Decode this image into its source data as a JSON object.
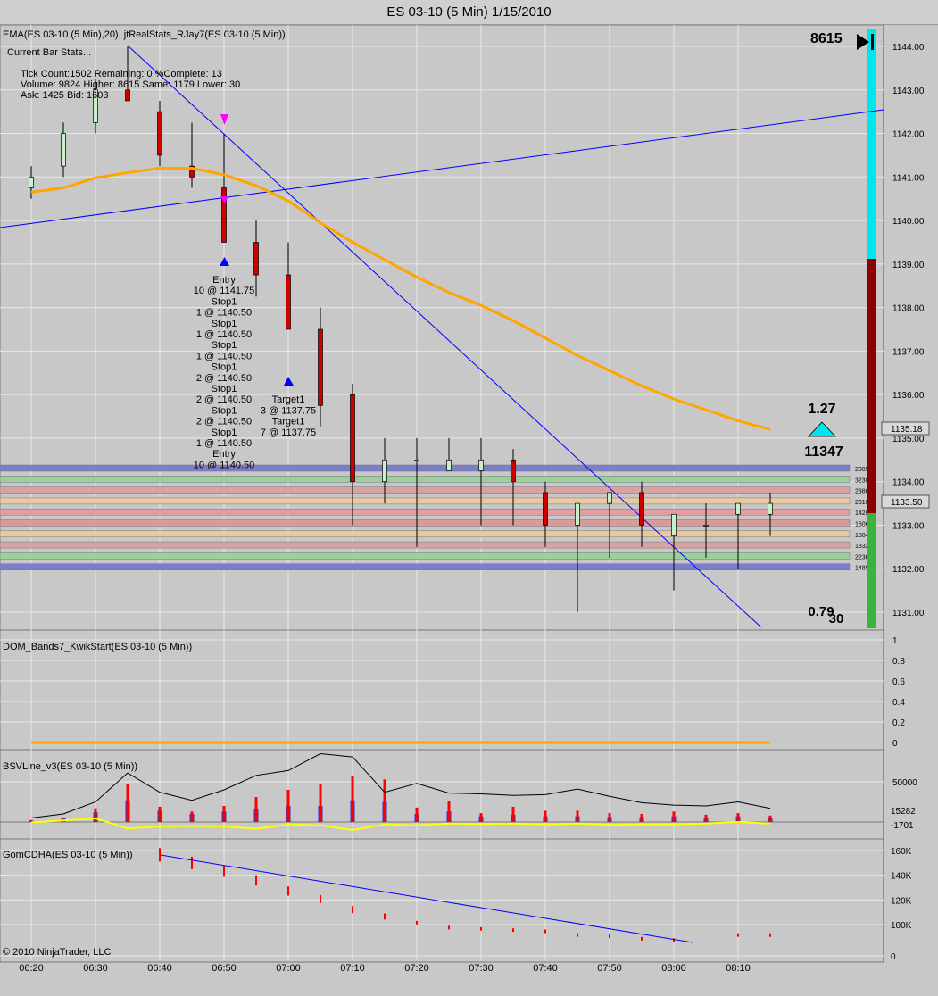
{
  "window": {
    "title": "ES 03-10 (5 Min)  1/15/2010"
  },
  "price_panel": {
    "indicator_label": "EMA(ES 03-10 (5 Min),20), jtRealStats_RJay7(ES 03-10 (5 Min))",
    "current_bar_stats_label": "Current Bar Stats...",
    "stats_line1": "Tick Count:1502   Remaining: 0   %Complete: 13",
    "stats_line2": "Volume: 9824   Higher: 8615   Same: 1179   Lower: 30",
    "stats_line3": "Ask: 1425   Bid: 1603",
    "top_right_value": "8615",
    "ratio_value": "1.27",
    "volume_value": "11347",
    "bottom_ratio": "0.79",
    "bottom_count": "30",
    "last_price_tag": "1133.50",
    "prev_price_tag": "1135.18",
    "trade_annotations_left": [
      "Entry",
      "10 @ 1141.75",
      "Stop1",
      "1 @ 1140.50",
      "Stop1",
      "1 @ 1140.50",
      "Stop1",
      "1 @ 1140.50",
      "Stop1",
      "2 @ 1140.50",
      "Stop1",
      "2 @ 1140.50",
      "Stop1",
      "2 @ 1140.50",
      "Stop1",
      "1 @ 1140.50",
      "Entry",
      "10 @ 1140.50"
    ],
    "trade_annotations_right": [
      "Target1",
      "3 @ 1137.75",
      "Target1",
      "7 @ 1137.75"
    ]
  },
  "dom_panel": {
    "label": "DOM_Bands7_KwikStart(ES 03-10 (5 Min))",
    "value_tag": "0"
  },
  "bsv_panel": {
    "label": "BSVLine_v3(ES 03-10 (5 Min))",
    "tag_top": "15282",
    "tag_bottom": "-1701"
  },
  "cdha_panel": {
    "label": "GomCDHA(ES 03-10 (5 Min))"
  },
  "copyright": "© 2010 NinjaTrader, LLC",
  "colors": {
    "background": "#c8c8c8",
    "ema": "#ffa500",
    "trendline": "#0000ff",
    "up_candle": "#c8f0c8",
    "down_candle": "#cc0000",
    "bsv_line": "#ffff00",
    "cdha": "#ff0000"
  },
  "chart_data": [
    {
      "type": "candlestick",
      "title": "ES 03-10 (5 Min)  1/15/2010",
      "x_ticks": [
        "06:20",
        "06:30",
        "06:40",
        "06:50",
        "07:00",
        "07:10",
        "07:20",
        "07:30",
        "07:40",
        "07:50",
        "08:00",
        "08:10"
      ],
      "y_ticks": [
        "1131.00",
        "1132.00",
        "1133.00",
        "1134.00",
        "1135.00",
        "1136.00",
        "1137.00",
        "1138.00",
        "1139.00",
        "1140.00",
        "1141.00",
        "1142.00",
        "1143.00",
        "1144.00"
      ],
      "ylim": [
        1130.6,
        1144.2
      ],
      "candles": [
        {
          "t": "06:20",
          "o": 1140.75,
          "h": 1141.25,
          "l": 1140.5,
          "c": 1141.0
        },
        {
          "t": "06:25",
          "o": 1141.25,
          "h": 1142.25,
          "l": 1141.0,
          "c": 1142.0
        },
        {
          "t": "06:30",
          "o": 1142.25,
          "h": 1143.25,
          "l": 1142.0,
          "c": 1143.0
        },
        {
          "t": "06:35",
          "o": 1143.0,
          "h": 1144.0,
          "l": 1142.75,
          "c": 1142.75
        },
        {
          "t": "06:40",
          "o": 1142.5,
          "h": 1142.75,
          "l": 1141.25,
          "c": 1141.5
        },
        {
          "t": "06:45",
          "o": 1141.25,
          "h": 1142.25,
          "l": 1140.75,
          "c": 1141.0
        },
        {
          "t": "06:50",
          "o": 1140.75,
          "h": 1142.0,
          "l": 1139.5,
          "c": 1139.5
        },
        {
          "t": "06:55",
          "o": 1139.5,
          "h": 1140.0,
          "l": 1138.25,
          "c": 1138.75
        },
        {
          "t": "07:00",
          "o": 1138.75,
          "h": 1139.5,
          "l": 1137.5,
          "c": 1137.5
        },
        {
          "t": "07:05",
          "o": 1137.5,
          "h": 1138.0,
          "l": 1135.25,
          "c": 1135.75
        },
        {
          "t": "07:10",
          "o": 1136.0,
          "h": 1136.25,
          "l": 1133.0,
          "c": 1134.0
        },
        {
          "t": "07:15",
          "o": 1134.0,
          "h": 1135.0,
          "l": 1133.5,
          "c": 1134.5
        },
        {
          "t": "07:20",
          "o": 1134.5,
          "h": 1135.0,
          "l": 1132.5,
          "c": 1134.5
        },
        {
          "t": "07:25",
          "o": 1134.25,
          "h": 1135.0,
          "l": 1134.25,
          "c": 1134.5
        },
        {
          "t": "07:30",
          "o": 1134.25,
          "h": 1135.0,
          "l": 1133.0,
          "c": 1134.5
        },
        {
          "t": "07:35",
          "o": 1134.5,
          "h": 1134.75,
          "l": 1133.0,
          "c": 1134.0
        },
        {
          "t": "07:40",
          "o": 1133.75,
          "h": 1134.0,
          "l": 1132.5,
          "c": 1133.0
        },
        {
          "t": "07:45",
          "o": 1133.0,
          "h": 1133.5,
          "l": 1131.0,
          "c": 1133.5
        },
        {
          "t": "07:50",
          "o": 1133.5,
          "h": 1133.75,
          "l": 1132.25,
          "c": 1133.75
        },
        {
          "t": "07:55",
          "o": 1133.75,
          "h": 1134.0,
          "l": 1132.5,
          "c": 1133.0
        },
        {
          "t": "08:00",
          "o": 1132.75,
          "h": 1133.25,
          "l": 1131.5,
          "c": 1133.25
        },
        {
          "t": "08:05",
          "o": 1133.0,
          "h": 1133.5,
          "l": 1132.25,
          "c": 1133.0
        },
        {
          "t": "08:10",
          "o": 1133.25,
          "h": 1133.5,
          "l": 1132.0,
          "c": 1133.5
        },
        {
          "t": "08:15",
          "o": 1133.25,
          "h": 1133.75,
          "l": 1132.75,
          "c": 1133.5
        }
      ],
      "ema20": [
        1140.65,
        1140.75,
        1140.98,
        1141.1,
        1141.2,
        1141.2,
        1141.05,
        1140.8,
        1140.45,
        1139.95,
        1139.5,
        1139.1,
        1138.7,
        1138.35,
        1138.05,
        1137.7,
        1137.3,
        1136.9,
        1136.55,
        1136.2,
        1135.9,
        1135.65,
        1135.4,
        1135.2
      ],
      "dom_bands_right_labels": [
        "2009",
        "3230",
        "2386",
        "2310",
        "1428",
        "1606",
        "1804",
        "1832",
        "2236",
        "1489"
      ]
    },
    {
      "type": "line",
      "title": "DOM_Bands7_KwikStart(ES 03-10 (5 Min))",
      "y_ticks": [
        "0.2",
        "0.4",
        "0.6",
        "0.8",
        "1"
      ],
      "ylim": [
        0,
        1.05
      ],
      "series": [
        {
          "values": [
            0,
            0,
            0,
            0,
            0,
            0,
            0,
            0,
            0,
            0,
            0,
            0,
            0,
            0,
            0,
            0,
            0,
            0,
            0,
            0,
            0,
            0,
            0,
            0
          ]
        }
      ]
    },
    {
      "type": "bar",
      "title": "BSVLine_v3(ES 03-10 (5 Min))",
      "y_ticks": [
        "50000"
      ],
      "ylim": [
        -8000,
        78000
      ],
      "series": [
        {
          "values": [
            1500,
            5000,
            12000,
            27000,
            14000,
            10000,
            13000,
            16000,
            20000,
            20000,
            27000,
            25000,
            10000,
            13000,
            7000,
            9000,
            7000,
            7000,
            6000,
            6000,
            7000,
            5000,
            7000,
            5000
          ]
        },
        {
          "values": [
            2500,
            4000,
            17000,
            47000,
            19000,
            13000,
            20000,
            31000,
            40000,
            47000,
            57000,
            53000,
            18000,
            26000,
            11000,
            19000,
            14000,
            14000,
            11000,
            10000,
            13000,
            9000,
            11000,
            8000
          ]
        },
        {
          "values": [
            5000,
            10000,
            25000,
            61000,
            37000,
            27000,
            40000,
            58000,
            64000,
            85000,
            81000,
            37000,
            48000,
            36000,
            35000,
            33000,
            34000,
            41000,
            32000,
            24000,
            21000,
            20000,
            25000,
            17000
          ]
        },
        {
          "values": [
            -500,
            2000,
            4500,
            -8000,
            -5500,
            -5000,
            -5500,
            -8500,
            -3000,
            -4000,
            -10000,
            -3000,
            -4000,
            -2000,
            -2500,
            -2000,
            -3000,
            -2000,
            -3500,
            -3000,
            -3000,
            -2000,
            0,
            -2000
          ]
        }
      ]
    },
    {
      "type": "bar",
      "title": "GomCDHA(ES 03-10 (5 Min))",
      "y_ticks": [
        "0",
        "100K",
        "120K",
        "140K",
        "160K"
      ],
      "ylim": [
        0,
        168000
      ],
      "series": [
        {
          "values": [
            null,
            null,
            null,
            null,
            162000,
            155000,
            148000,
            140000,
            131000,
            124000,
            115000,
            109000,
            103000,
            99000,
            98000,
            97000,
            96000,
            93000,
            92000,
            90000,
            89000,
            null,
            93000,
            93000
          ]
        }
      ]
    }
  ]
}
